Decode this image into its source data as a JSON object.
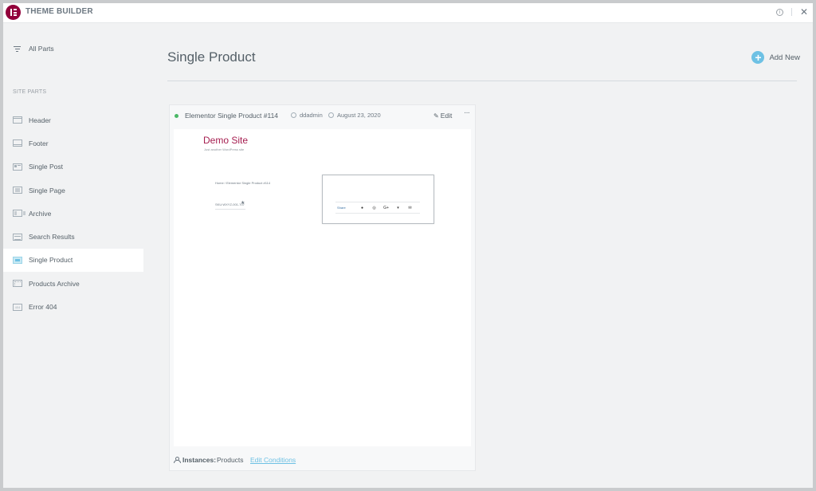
{
  "app": {
    "title": "THEME BUILDER"
  },
  "sidebar": {
    "all_parts": "All Parts",
    "section_heading": "SITE PARTS",
    "items": [
      {
        "label": "Header",
        "icon": "header-icon"
      },
      {
        "label": "Footer",
        "icon": "footer-icon"
      },
      {
        "label": "Single Post",
        "icon": "single-post-icon"
      },
      {
        "label": "Single Page",
        "icon": "single-page-icon"
      },
      {
        "label": "Archive",
        "icon": "archive-icon"
      },
      {
        "label": "Search Results",
        "icon": "search-results-icon"
      },
      {
        "label": "Single Product",
        "icon": "single-product-icon",
        "active": true
      },
      {
        "label": "Products Archive",
        "icon": "products-archive-icon"
      },
      {
        "label": "Error 404",
        "icon": "error-404-icon"
      }
    ]
  },
  "main": {
    "page_title": "Single Product",
    "add_new": "Add New"
  },
  "card": {
    "title": "Elementor Single Product #114",
    "author": "ddadmin",
    "date": "August 23, 2020",
    "edit": "Edit",
    "more": "···",
    "status_color": "#4ab866",
    "preview": {
      "site_name": "Demo Site",
      "tagline": "Just another WordPress site",
      "breadcrumb": "Home / Elementor Single Product #114",
      "sku": "SKU:WXYZ-001-707",
      "share_label": "Share"
    },
    "footer": {
      "instances_label": "Instances:",
      "instances_value": "Products",
      "edit_conditions": "Edit Conditions"
    }
  },
  "colors": {
    "brand": "#92003b",
    "accent": "#6ec1e4",
    "site_title": "#a51d4f"
  }
}
